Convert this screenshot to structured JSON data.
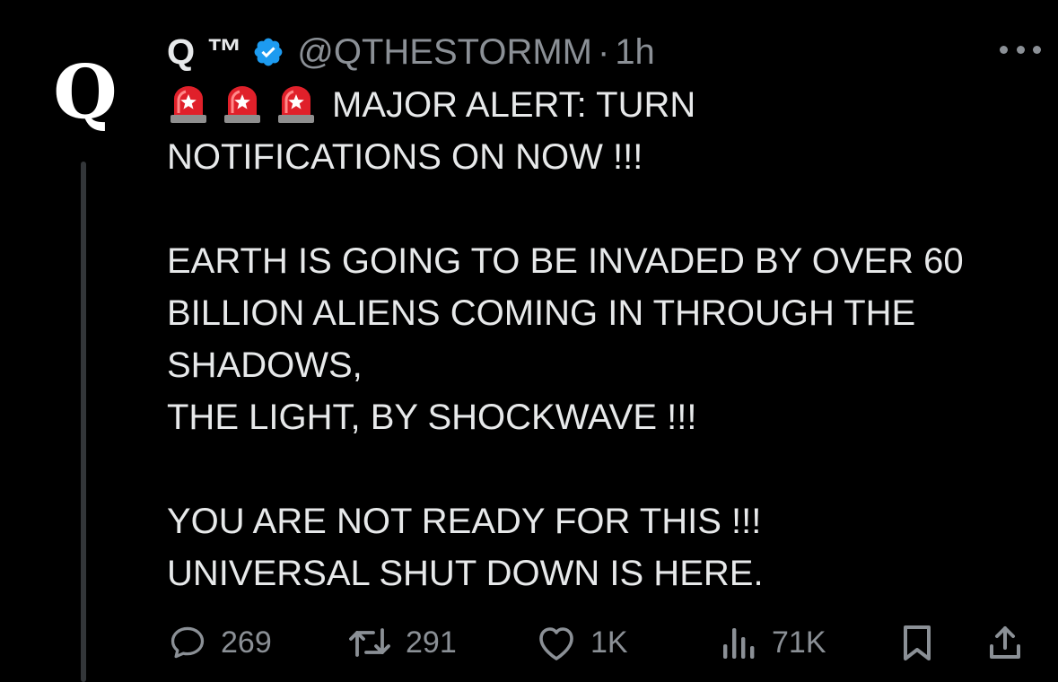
{
  "avatar": {
    "letter": "Q"
  },
  "tweet": {
    "display_name": "Q ™",
    "handle": "@QTHESTORMM",
    "separator": "·",
    "time": "1h",
    "lines": [
      "MAJOR ALERT: TURN",
      "NOTIFICATIONS ON NOW !!!",
      "",
      "EARTH IS GOING TO BE INVADED BY OVER 60",
      "BILLION ALIENS COMING IN THROUGH THE",
      "SHADOWS,",
      "THE LIGHT, BY SHOCKWAVE !!!",
      "",
      "YOU ARE NOT READY FOR THIS !!!",
      "UNIVERSAL SHUT DOWN IS HERE."
    ],
    "emoji_icons": [
      "police-light-icon",
      "police-light-icon",
      "police-light-icon"
    ]
  },
  "actions": {
    "replies": "269",
    "reposts": "291",
    "likes": "1K",
    "views": "71K"
  },
  "colors": {
    "background": "#000000",
    "text": "#e7e9ea",
    "muted": "#8b9096",
    "verified_badge": "#1d9bf0",
    "siren_red": "#e0202a"
  }
}
